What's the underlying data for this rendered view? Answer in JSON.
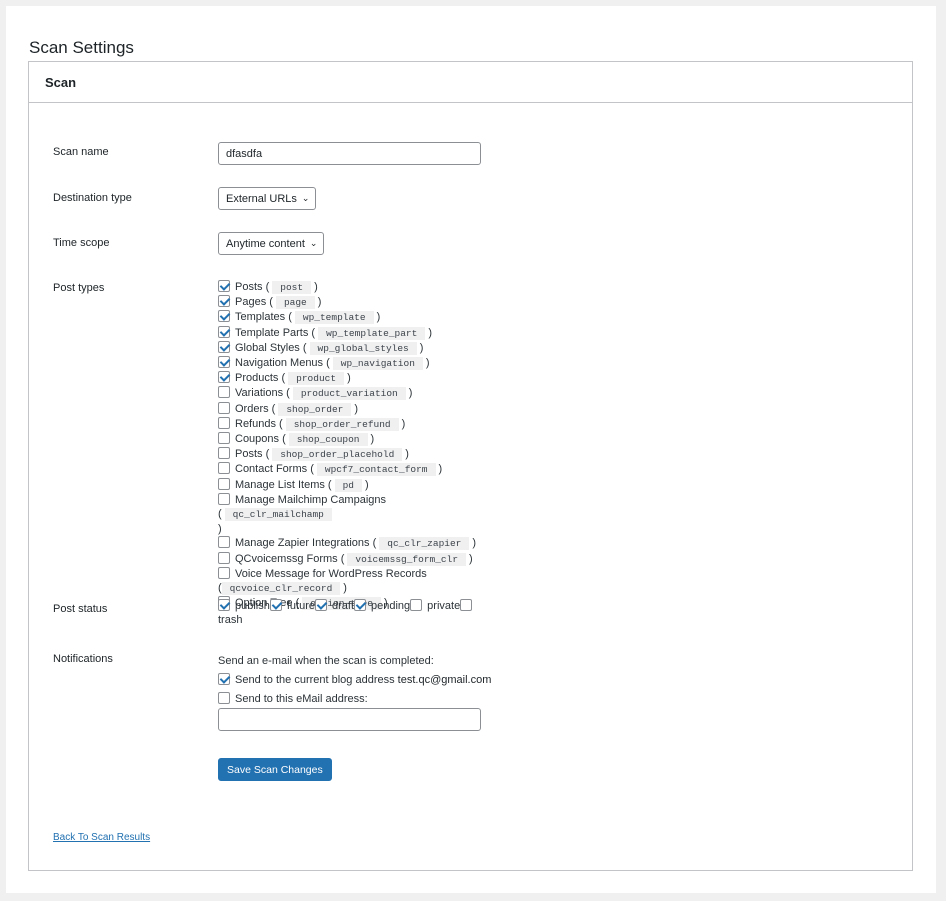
{
  "page_title": "Scan Settings",
  "card_title": "Scan",
  "fields": {
    "scan_name": {
      "label": "Scan name",
      "value": "dfasdfa"
    },
    "destination_type": {
      "label": "Destination type",
      "selected": "External URLs"
    },
    "time_scope": {
      "label": "Time scope",
      "selected": "Anytime content"
    },
    "post_types": {
      "label": "Post types",
      "items": [
        {
          "label": "Posts",
          "slug": "post",
          "checked": true
        },
        {
          "label": "Pages",
          "slug": "page",
          "checked": true
        },
        {
          "label": "Templates",
          "slug": "wp_template",
          "checked": true
        },
        {
          "label": "Template Parts",
          "slug": "wp_template_part",
          "checked": true
        },
        {
          "label": "Global Styles",
          "slug": "wp_global_styles",
          "checked": true
        },
        {
          "label": "Navigation Menus",
          "slug": "wp_navigation",
          "checked": true
        },
        {
          "label": "Products",
          "slug": "product",
          "checked": true
        },
        {
          "label": "Variations",
          "slug": "product_variation",
          "checked": false
        },
        {
          "label": "Orders",
          "slug": "shop_order",
          "checked": false
        },
        {
          "label": "Refunds",
          "slug": "shop_order_refund",
          "checked": false
        },
        {
          "label": "Coupons",
          "slug": "shop_coupon",
          "checked": false
        },
        {
          "label": "Posts",
          "slug": "shop_order_placehold",
          "checked": false
        },
        {
          "label": "Contact Forms",
          "slug": "wpcf7_contact_form",
          "checked": false
        },
        {
          "label": "Manage List Items",
          "slug": "pd",
          "checked": false
        },
        {
          "label": "Manage Mailchimp Campaigns",
          "slug": "qc_clr_mailchamp",
          "checked": false
        },
        {
          "label": "Manage Zapier Integrations",
          "slug": "qc_clr_zapier",
          "checked": false
        },
        {
          "label": "QCvoicemssg Forms",
          "slug": "voicemssg_form_clr",
          "checked": false
        },
        {
          "label": "Voice Message for WordPress Records",
          "slug": "qcvoice_clr_record",
          "checked": false
        },
        {
          "label": "Option Tree",
          "slug": "option-tree",
          "checked": false
        }
      ]
    },
    "post_status": {
      "label": "Post status",
      "items": [
        {
          "label": "publish",
          "checked": true
        },
        {
          "label": "future",
          "checked": true
        },
        {
          "label": "draft",
          "checked": true
        },
        {
          "label": "pending",
          "checked": true
        },
        {
          "label": "private",
          "checked": false
        },
        {
          "label": "trash",
          "checked": false
        }
      ]
    },
    "notifications": {
      "label": "Notifications",
      "intro": "Send an e-mail when the scan is completed:",
      "current_blog_label": "Send to the current blog address",
      "current_blog_email": "test.qc@gmail.com",
      "current_blog_checked": true,
      "custom_label": "Send to this eMail address:",
      "custom_checked": false,
      "custom_value": ""
    }
  },
  "save_button": "Save Scan Changes",
  "back_link": "Back To Scan Results",
  "accent_color": "#2271b1"
}
